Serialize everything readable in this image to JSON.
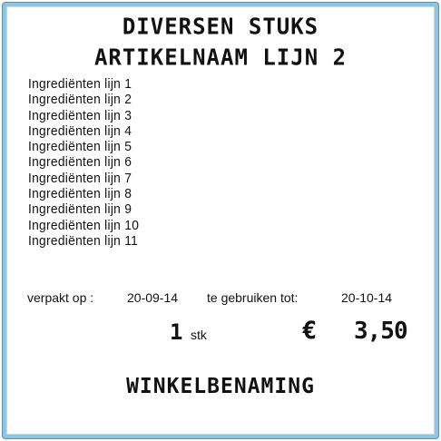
{
  "title": {
    "line1": "DIVERSEN STUKS",
    "line2": "ARTIKELNAAM LIJN 2"
  },
  "ingredients": [
    "Ingrediënten lijn 1",
    "Ingrediënten lijn 2",
    "Ingrediënten lijn 3",
    "Ingrediënten lijn 4",
    "Ingrediënten lijn 5",
    "Ingrediënten lijn 6",
    "Ingrediënten lijn 7",
    "Ingrediënten lijn 8",
    "Ingrediënten lijn 9",
    "Ingrediënten lijn 10",
    "Ingrediënten lijn 11"
  ],
  "dates": {
    "packed_label": "verpakt op :",
    "packed_value": "20-09-14",
    "use_by_label": "te gebruiken tot:",
    "use_by_value": "20-10-14"
  },
  "quantity": {
    "value": "1",
    "unit": "stk"
  },
  "price": {
    "currency": "€",
    "value": "3,50"
  },
  "store_name": "WINKELBENAMING",
  "colors": {
    "frame_border": "#8fc5e2",
    "text": "#111111",
    "background": "#ffffff"
  }
}
